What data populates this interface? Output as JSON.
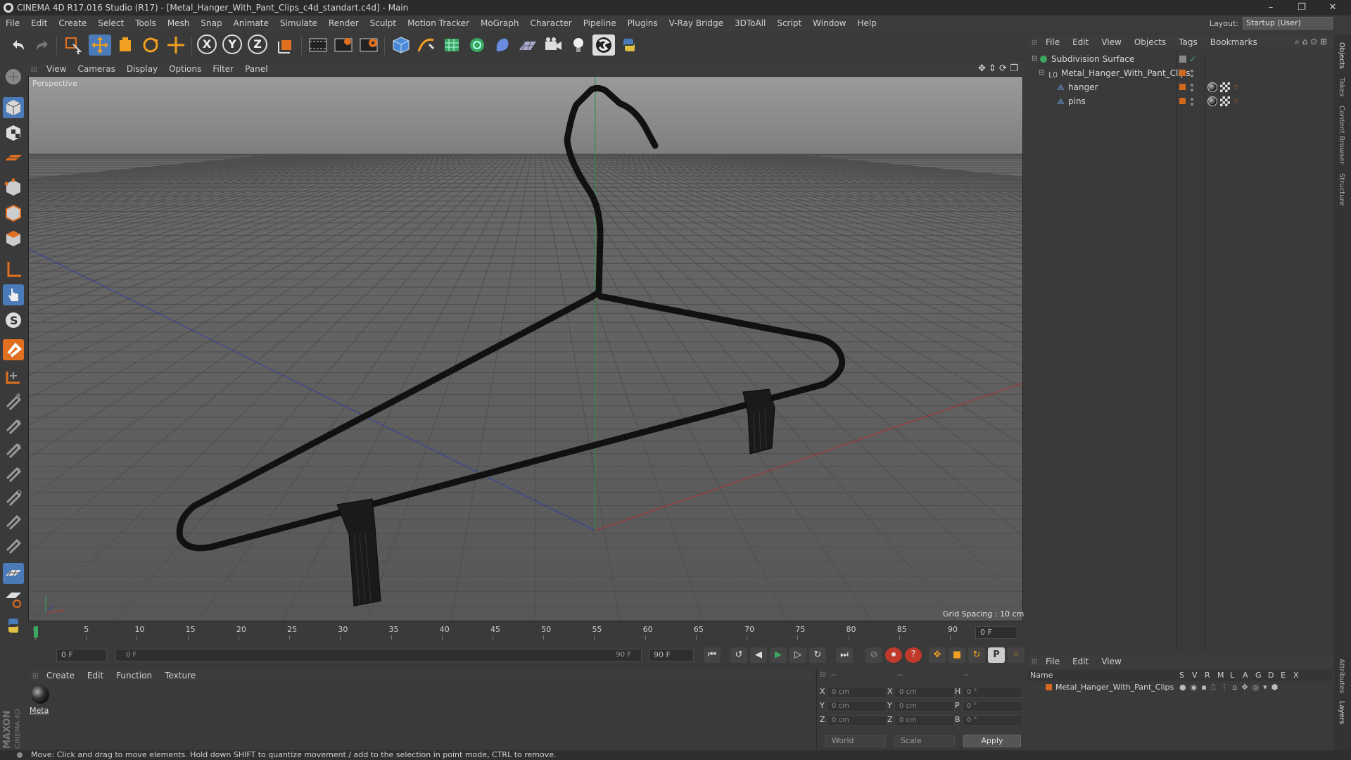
{
  "window": {
    "title": "CINEMA 4D R17.016 Studio (R17) - [Metal_Hanger_With_Pant_Clips_c4d_standart.c4d] - Main",
    "minimize": "–",
    "restore": "❐",
    "close": "✕"
  },
  "menubar": {
    "items": [
      "File",
      "Edit",
      "Create",
      "Select",
      "Tools",
      "Mesh",
      "Snap",
      "Animate",
      "Simulate",
      "Render",
      "Sculpt",
      "Motion Tracker",
      "MoGraph",
      "Character",
      "Pipeline",
      "Plugins",
      "V-Ray Bridge",
      "3DToAll",
      "Script",
      "Window",
      "Help"
    ],
    "layout_label": "Layout:",
    "layout_value": "Startup (User)"
  },
  "toolbar": {
    "axis_x": "X",
    "axis_y": "Y",
    "axis_z": "Z"
  },
  "viewport": {
    "menu": [
      "View",
      "Cameras",
      "Display",
      "Options",
      "Filter",
      "Panel"
    ],
    "camera_label": "Perspective",
    "grid_spacing": "Grid Spacing : 10 cm"
  },
  "timeline": {
    "ticks": [
      "0",
      "5",
      "10",
      "15",
      "20",
      "25",
      "30",
      "35",
      "40",
      "45",
      "50",
      "55",
      "60",
      "65",
      "70",
      "75",
      "80",
      "85",
      "90"
    ],
    "current_frame": "0 F",
    "start_field": "0 F",
    "range_start": "0 F",
    "range_end": "90 F",
    "end_field": "90 F"
  },
  "material_manager": {
    "menu": [
      "Create",
      "Edit",
      "Function",
      "Texture"
    ],
    "materials": [
      {
        "name": "Meta"
      }
    ]
  },
  "coordinates": {
    "header_a": "--",
    "header_b": "--",
    "header_c": "--",
    "rows": [
      {
        "axis": "X",
        "pos": "0 cm",
        "axis2": "X",
        "size": "0 cm",
        "rot_label": "H",
        "rot": "0 °"
      },
      {
        "axis": "Y",
        "pos": "0 cm",
        "axis2": "Y",
        "size": "0 cm",
        "rot_label": "P",
        "rot": "0 °"
      },
      {
        "axis": "Z",
        "pos": "0 cm",
        "axis2": "Z",
        "size": "0 cm",
        "rot_label": "B",
        "rot": "0 °"
      }
    ],
    "mode": "World",
    "scale_mode": "Scale",
    "apply": "Apply"
  },
  "object_manager": {
    "menu": [
      "File",
      "Edit",
      "View",
      "Objects",
      "Tags",
      "Bookmarks"
    ],
    "objects": [
      {
        "name": "Subdivision Surface",
        "level": 0
      },
      {
        "name": "Metal_Hanger_With_Pant_Clips",
        "level": 1
      },
      {
        "name": "hanger",
        "level": 2
      },
      {
        "name": "pins",
        "level": 2
      }
    ]
  },
  "layer_manager": {
    "menu": [
      "File",
      "Edit",
      "View"
    ],
    "columns": [
      "Name",
      "S",
      "V",
      "R",
      "M",
      "L",
      "A",
      "G",
      "D",
      "E",
      "X"
    ],
    "layers": [
      {
        "name": "Metal_Hanger_With_Pant_Clips",
        "color": "#d2691e"
      }
    ]
  },
  "side_tabs": [
    "Objects",
    "Takes",
    "Content Browser",
    "Structure",
    "Attributes",
    "Layers"
  ],
  "status": {
    "text": "Move: Click and drag to move elements. Hold down SHIFT to quantize movement / add to the selection in point mode, CTRL to remove."
  },
  "branding": {
    "maxon": "MAXON",
    "c4d": "CINEMA 4D"
  },
  "colors": {
    "accent_orange": "#d2691e",
    "active_blue": "#4a7ab8",
    "x_axis": "#c0392b",
    "y_axis": "#27ae60",
    "z_axis": "#2c3e9e"
  }
}
